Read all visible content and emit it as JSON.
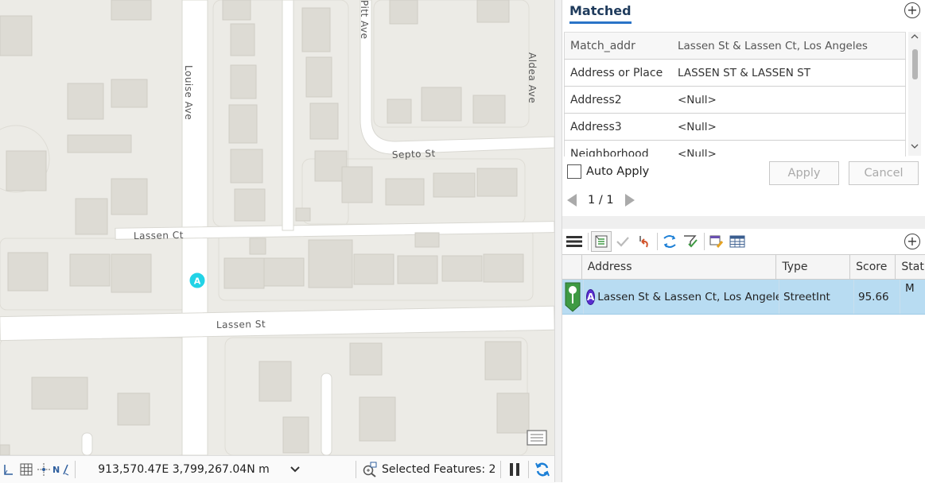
{
  "map": {
    "streets": {
      "louise": "Louise Ave",
      "pitt": "Pitt Ave",
      "aldea": "Aldea Ave",
      "septo": "Septo St",
      "lassen_ct": "Lassen Ct",
      "lassen_st": "Lassen St"
    },
    "marker_label": "A",
    "status": {
      "coordinates": "913,570.47E 3,799,267.04N m",
      "selected_features": "Selected Features: 2"
    }
  },
  "panel": {
    "tab_title": "Matched",
    "attributes": [
      {
        "name": "Match_addr",
        "value": "Lassen St & Lassen Ct, Los Angeles"
      },
      {
        "name": "Address or Place",
        "value": "LASSEN ST & LASSEN ST"
      },
      {
        "name": "Address2",
        "value": "<Null>"
      },
      {
        "name": "Address3",
        "value": "<Null>"
      },
      {
        "name": "Neighborhood",
        "value": "<Null>"
      }
    ],
    "auto_apply_label": "Auto Apply",
    "apply_label": "Apply",
    "cancel_label": "Cancel",
    "pager_text": "1 / 1",
    "results": {
      "columns": [
        "Address",
        "Type",
        "Score",
        "Stat"
      ],
      "rows": [
        {
          "badge": "A",
          "address": "Lassen St & Lassen Ct, Los Angeles",
          "type": "StreetInt",
          "score": "95.66",
          "status": "M"
        }
      ]
    }
  },
  "colors": {
    "accent": "#2a74c7",
    "selection": "#b8dcf2",
    "marker": "#22d3e6",
    "badge": "#5a2ed0",
    "pin": "#3e9a43"
  }
}
